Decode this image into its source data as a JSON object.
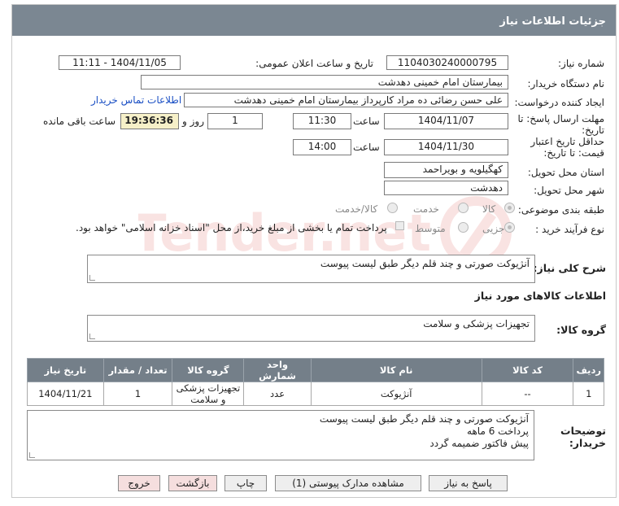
{
  "header": {
    "title": "جزئیات اطلاعات نیاز"
  },
  "labels": {
    "need_number": "شماره نیاز:",
    "announce_datetime": "تاریخ و ساعت اعلان عمومی:",
    "buyer_org": "نام دستگاه خریدار:",
    "requester": "ایجاد کننده درخواست:",
    "reply_deadline_line1": "مهلت ارسال پاسخ: تا",
    "reply_deadline_line2": "تاریخ:",
    "price_validity_line1": "حداقل تاریخ اعتبار",
    "price_validity_line2": "قیمت: تا تاریخ:",
    "time_word": "ساعت",
    "day_and": "روز و",
    "hours_remaining": "ساعت باقی مانده",
    "province": "استان محل تحویل:",
    "city": "شهر محل تحویل:",
    "category": "طبقه بندی موضوعی:",
    "process_type": "نوع فرآیند خرید :",
    "general_desc": "شرح کلی نیاز:",
    "goods_info": "اطلاعات کالاهای مورد نیاز",
    "goods_group": "گروه کالا:",
    "buyer_notes_line1": "توضیحات",
    "buyer_notes_line2": "خریدار:"
  },
  "fields": {
    "need_number": "1104030240000795",
    "announce_datetime": "1404/11/05 - 11:11",
    "buyer_org": "بیمارستان امام خمینی دهدشت",
    "requester": "علی حسن رضائی ده مراد کارپرداز بیمارستان امام خمینی دهدشت",
    "contact_link": "اطلاعات تماس خریدار",
    "reply_date": "1404/11/07",
    "reply_time": "11:30",
    "days": "1",
    "remaining_time": "19:36:36",
    "validity_date": "1404/11/30",
    "validity_time": "14:00",
    "province": "کهگیلویه و بویراحمد",
    "city": "دهدشت",
    "general_desc": "آنژیوکت صورتی و چند قلم دیگر طبق لیست پیوست",
    "goods_group": "تجهیزات پزشکی و سلامت",
    "buyer_notes": [
      "آنژیوکت صورتی و چند قلم دیگر طبق لیست پیوست",
      "پرداخت 6 ماهه",
      "پیش فاکتور ضمیمه گردد"
    ]
  },
  "category_options": {
    "goods": "کالا",
    "service": "خدمت",
    "goods_service": "کالا/خدمت",
    "selected": "کالا"
  },
  "process_options": {
    "partial": "جزیی",
    "medium": "متوسط",
    "treasury_note": "پرداخت تمام یا بخشی از مبلغ خرید،از محل \"اسناد خزانه اسلامی\" خواهد بود.",
    "selected": "جزیی"
  },
  "table": {
    "headers": [
      "ردیف",
      "کد کالا",
      "نام کالا",
      "واحد شمارش",
      "گروه کالا",
      "تعداد / مقدار",
      "تاریخ نیاز"
    ],
    "rows": [
      [
        "1",
        "--",
        "آنژیوکت",
        "عدد",
        "تجهیزات پزشکی و سلامت",
        "1",
        "1404/11/21"
      ]
    ]
  },
  "buttons": {
    "reply": "پاسخ به نیاز",
    "attachments": "مشاهده مدارک پیوستی (1)",
    "print": "چاپ",
    "back": "بازگشت",
    "exit": "خروج"
  },
  "watermark": {
    "text": "AriaTender.net"
  }
}
